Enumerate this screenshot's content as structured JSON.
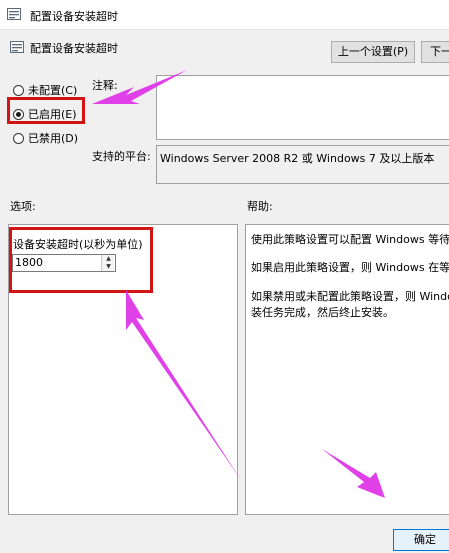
{
  "window": {
    "title": "配置设备安装超时"
  },
  "header": {
    "title": "配置设备安装超时"
  },
  "nav": {
    "prev_label": "上一个设置(P)",
    "next_label": "下一"
  },
  "state": {
    "options": [
      {
        "label": "未配置(C)",
        "selected": false
      },
      {
        "label": "已启用(E)",
        "selected": true
      },
      {
        "label": "已禁用(D)",
        "selected": false
      }
    ]
  },
  "comment": {
    "label": "注释:",
    "value": ""
  },
  "platform": {
    "label": "支持的平台:",
    "value": "Windows Server 2008 R2 或 Windows 7 及以上版本"
  },
  "options_section": {
    "label": "选项:",
    "timeout_label": "设备安装超时(以秒为单位)",
    "timeout_value": "1800"
  },
  "help_section": {
    "label": "帮助:",
    "paragraphs": [
      "使用此策略设置可以配置 Windows 等待设",
      "如果启用此策略设置，则 Windows 在等待",
      "如果禁用或未配置此策略设置，则 Window",
      "装任务完成，然后终止安装。"
    ]
  },
  "footer": {
    "ok_label": "确定"
  },
  "colors": {
    "annotation_red": "#d11414",
    "annotation_arrow": "#e040e8",
    "accent": "#0078d7"
  },
  "icons": {
    "policy": "policy-icon"
  }
}
